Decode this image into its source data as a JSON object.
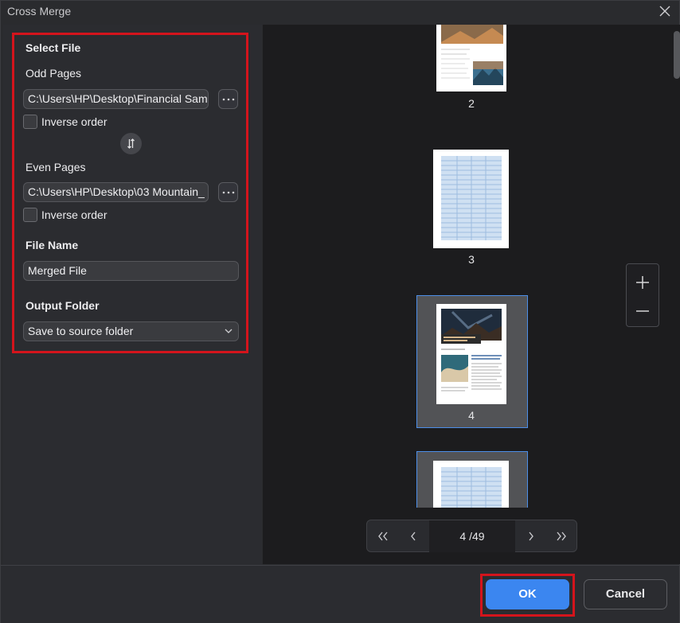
{
  "window": {
    "title": "Cross Merge"
  },
  "form": {
    "select_file_label": "Select File",
    "odd_pages": {
      "label": "Odd Pages",
      "path": "C:\\Users\\HP\\Desktop\\Financial Sam",
      "inverse_label": "Inverse order"
    },
    "even_pages": {
      "label": "Even Pages",
      "path": "C:\\Users\\HP\\Desktop\\03 Mountain_",
      "inverse_label": "Inverse order"
    },
    "file_name": {
      "label": "File Name",
      "value": "Merged File"
    },
    "output_folder": {
      "label": "Output Folder",
      "value": "Save to source folder"
    }
  },
  "preview": {
    "pages": [
      {
        "number": "2"
      },
      {
        "number": "3"
      },
      {
        "number": "4"
      }
    ],
    "pager": {
      "current": "4",
      "separator": " /",
      "total": "49",
      "display": "4 /49"
    }
  },
  "footer": {
    "ok_label": "OK",
    "cancel_label": "Cancel"
  },
  "colors": {
    "accent": "#3b86f0",
    "highlight": "#d4141c",
    "selection": "#4c8ee8"
  }
}
